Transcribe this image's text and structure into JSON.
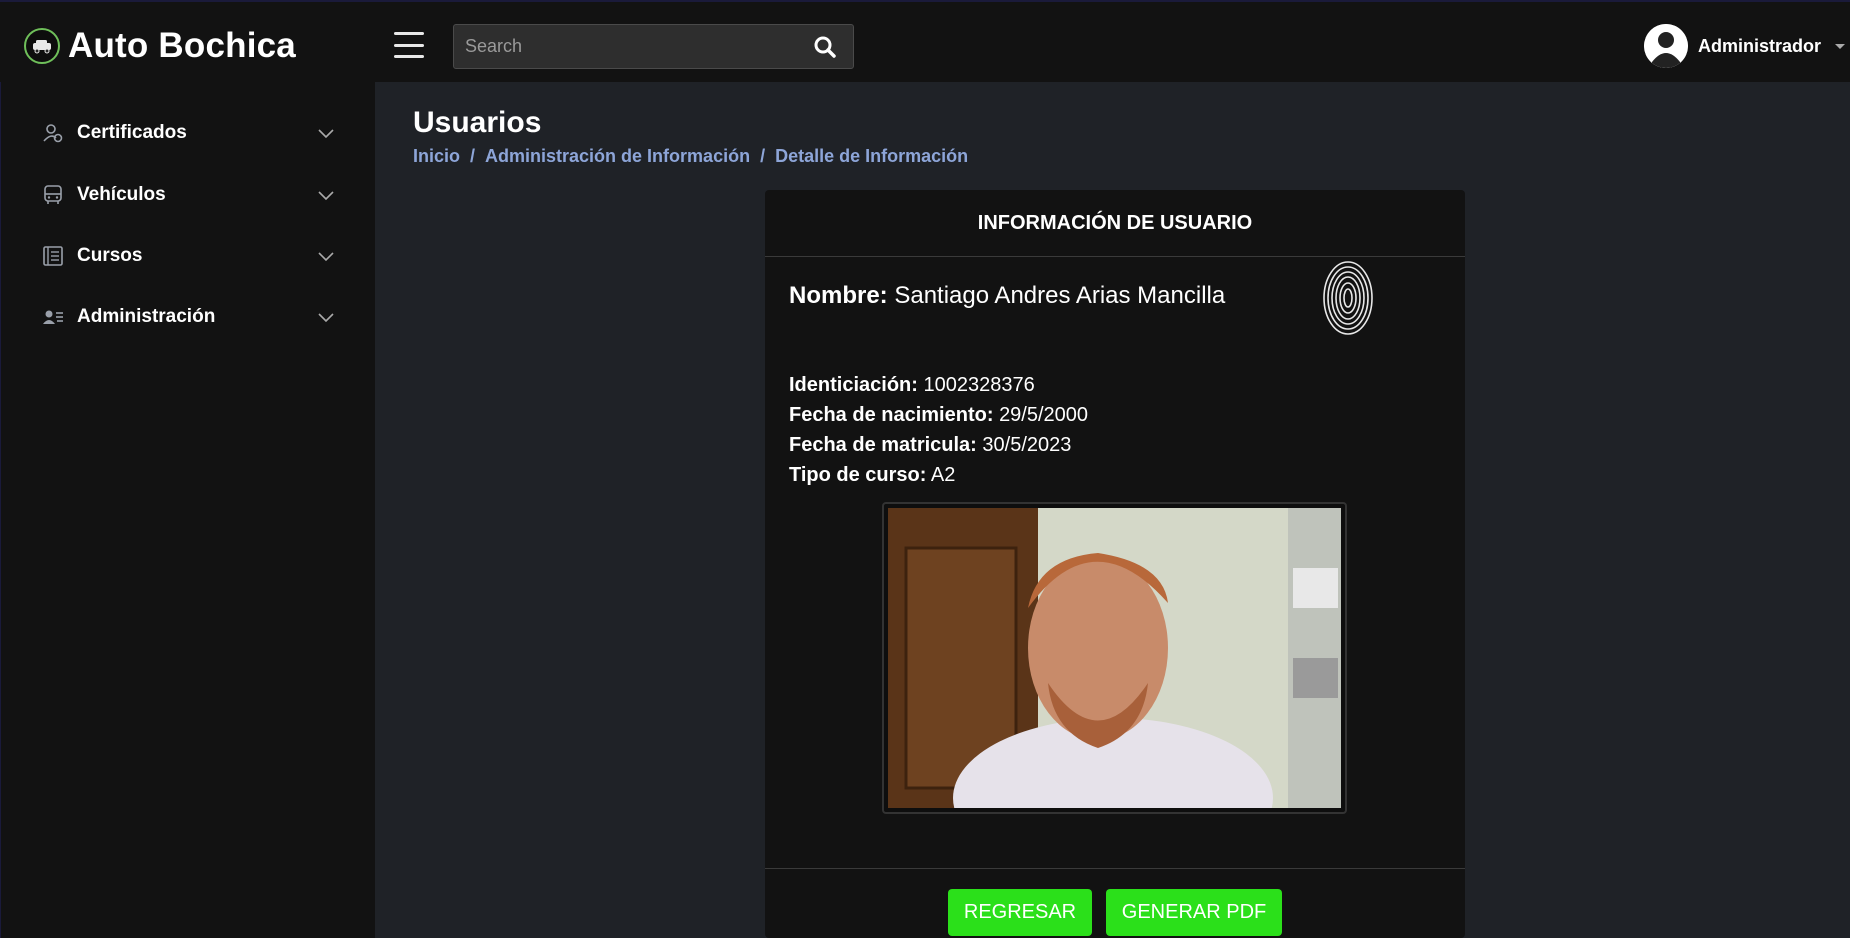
{
  "brand": {
    "name": "Auto Bochica",
    "logo_icon": "car-logo-icon"
  },
  "search": {
    "placeholder": "Search"
  },
  "user": {
    "name": "Administrador"
  },
  "sidebar": {
    "items": [
      {
        "label": "Certificados",
        "icon": "user-certificate-icon"
      },
      {
        "label": "Vehículos",
        "icon": "bus-icon"
      },
      {
        "label": "Cursos",
        "icon": "list-icon"
      },
      {
        "label": "Administración",
        "icon": "users-admin-icon"
      }
    ]
  },
  "page": {
    "title": "Usuarios",
    "breadcrumb": [
      "Inicio",
      "Administración de Información",
      "Detalle de Información"
    ],
    "breadcrumb_sep": "/"
  },
  "card": {
    "header": "INFORMACIÓN DE USUARIO",
    "nombre_label": "Nombre:",
    "nombre_value": "Santiago Andres Arias Mancilla",
    "fields": [
      {
        "label": "Identiciación:",
        "value": "1002328376"
      },
      {
        "label": "Fecha de nacimiento:",
        "value": "29/5/2000"
      },
      {
        "label": "Fecha de matricula:",
        "value": "30/5/2023"
      },
      {
        "label": "Tipo de curso:",
        "value": "A2"
      }
    ],
    "buttons": {
      "back": "REGRESAR",
      "pdf": "GENERAR PDF"
    }
  },
  "colors": {
    "accent_button": "#2be01a",
    "breadcrumb": "#8da5d8",
    "background": "#1f2227",
    "panel": "#121212"
  }
}
